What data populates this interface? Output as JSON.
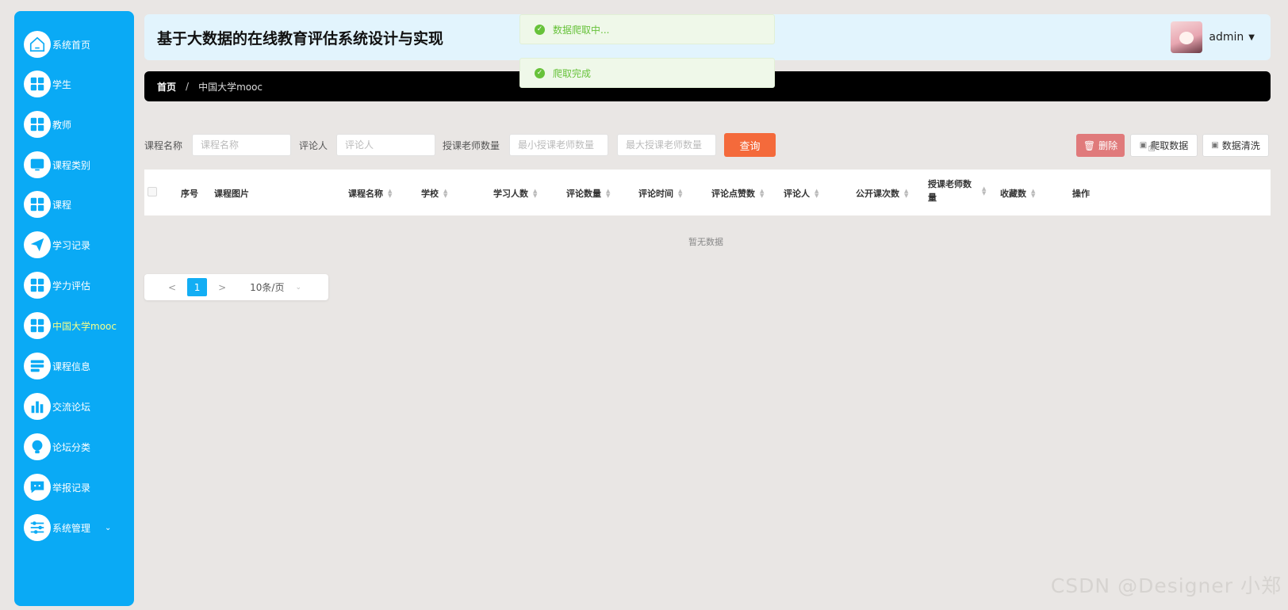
{
  "app": {
    "title": "基于大数据的在线教育评估系统设计与实现",
    "user": "admin"
  },
  "sidebar": {
    "items": [
      {
        "label": "系统首页",
        "icon": "home-icon"
      },
      {
        "label": "学生",
        "icon": "grid-icon"
      },
      {
        "label": "教师",
        "icon": "grid-icon"
      },
      {
        "label": "课程类别",
        "icon": "monitor-icon"
      },
      {
        "label": "课程",
        "icon": "grid-icon"
      },
      {
        "label": "学习记录",
        "icon": "send-icon"
      },
      {
        "label": "学力评估",
        "icon": "grid-icon"
      },
      {
        "label": "中国大学mooc",
        "icon": "grid-icon",
        "active": true
      },
      {
        "label": "课程信息",
        "icon": "list-icon"
      },
      {
        "label": "交流论坛",
        "icon": "bar-chart-icon"
      },
      {
        "label": "论坛分类",
        "icon": "bulb-icon"
      },
      {
        "label": "举报记录",
        "icon": "chat-icon"
      },
      {
        "label": "系统管理",
        "icon": "sliders-icon"
      }
    ]
  },
  "breadcrumb": {
    "home": "首页",
    "separator": "/",
    "current": "中国大学mooc"
  },
  "toasts": [
    {
      "text": "数据爬取中..."
    },
    {
      "text": "爬取完成"
    }
  ],
  "search": {
    "course_label": "课程名称",
    "course_placeholder": "课程名称",
    "reviewer_label": "评论人",
    "reviewer_placeholder": "评论人",
    "teacher_count_label": "授课老师数量",
    "min_placeholder": "最小授课老师数量",
    "max_placeholder": "最大授课老师数量",
    "query_button": "查询"
  },
  "actions": {
    "delete": "删除",
    "crawl": "爬取数据",
    "clean": "数据清洗"
  },
  "table": {
    "columns": [
      "序号",
      "课程图片",
      "课程名称",
      "学校",
      "学习人数",
      "评论数量",
      "评论时间",
      "评论点赞数",
      "评论人",
      "公开课次数",
      "授课老师数量",
      "收藏数",
      "操作"
    ],
    "empty_text": "暂无数据"
  },
  "pagination": {
    "prev": "<",
    "current_page": "1",
    "next": ">",
    "page_size": "10条/页"
  },
  "watermark": "CSDN @Designer 小郑",
  "colors": {
    "sidebar": "#0aaaf5",
    "header": "#e2f4fd",
    "query": "#f46a3b",
    "delete": "#e07a7b",
    "toast": "#67c23a"
  }
}
